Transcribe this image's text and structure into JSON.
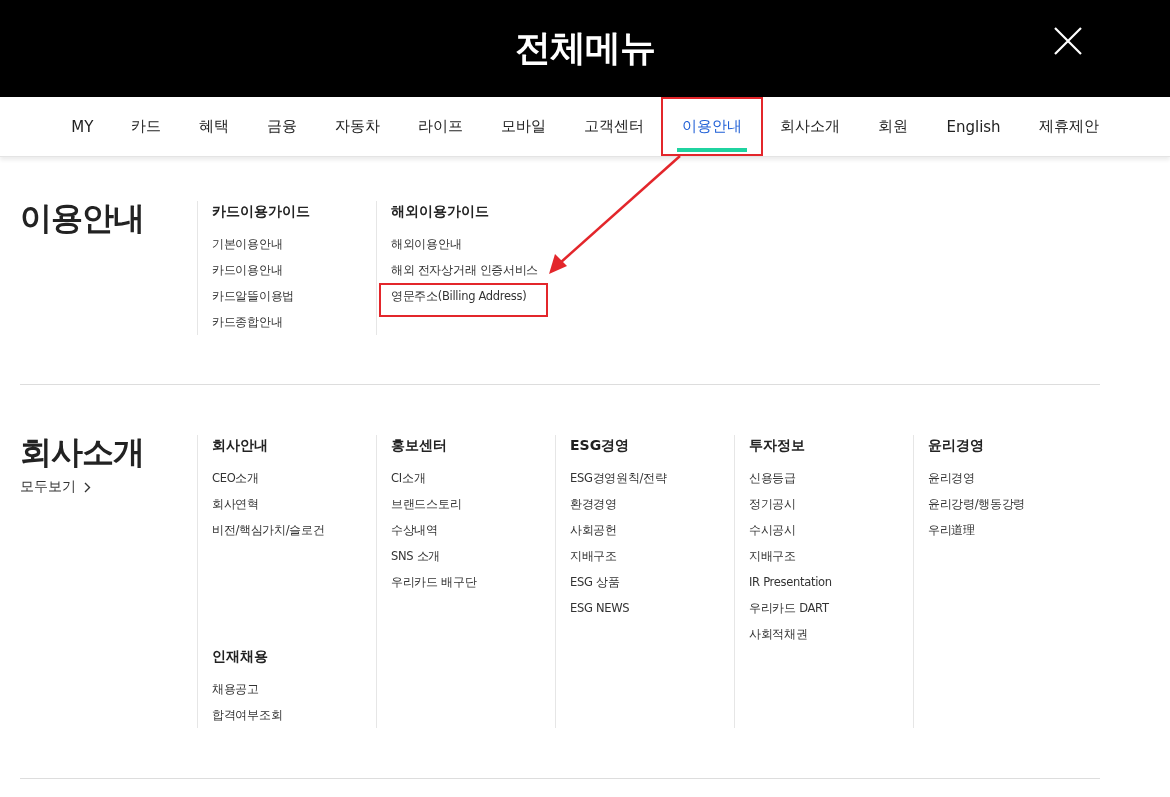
{
  "header": {
    "title": "전체메뉴"
  },
  "nav_tabs": [
    {
      "label": "MY",
      "selected": false,
      "boxed": false
    },
    {
      "label": "카드",
      "selected": false,
      "boxed": false
    },
    {
      "label": "혜택",
      "selected": false,
      "boxed": false
    },
    {
      "label": "금융",
      "selected": false,
      "boxed": false
    },
    {
      "label": "자동차",
      "selected": false,
      "boxed": false
    },
    {
      "label": "라이프",
      "selected": false,
      "boxed": false
    },
    {
      "label": "모바일",
      "selected": false,
      "boxed": false
    },
    {
      "label": "고객센터",
      "selected": false,
      "boxed": false
    },
    {
      "label": "이용안내",
      "selected": true,
      "boxed": true
    },
    {
      "label": "회사소개",
      "selected": false,
      "boxed": false
    },
    {
      "label": "회원",
      "selected": false,
      "boxed": false
    },
    {
      "label": "English",
      "selected": false,
      "boxed": false
    },
    {
      "label": "제휴제안",
      "selected": false,
      "boxed": false
    }
  ],
  "sections": [
    {
      "title": "이용안내",
      "columns": [
        [
          {
            "heading": "카드이용가이드",
            "links": [
              {
                "label": "기본이용안내",
                "boxed": false
              },
              {
                "label": "카드이용안내",
                "boxed": false
              },
              {
                "label": "카드알뜰이용법",
                "boxed": false
              },
              {
                "label": "카드종합안내",
                "boxed": false
              }
            ]
          }
        ],
        [
          {
            "heading": "해외이용가이드",
            "links": [
              {
                "label": "해외이용안내",
                "boxed": false
              },
              {
                "label": "해외 전자상거래 인증서비스",
                "boxed": false
              },
              {
                "label": "영문주소(Billing Address)",
                "boxed": true
              }
            ]
          }
        ]
      ]
    },
    {
      "title": "회사소개",
      "view_all": "모두보기",
      "columns": [
        [
          {
            "heading": "회사안내",
            "links": [
              {
                "label": "CEO소개",
                "boxed": false
              },
              {
                "label": "회사연혁",
                "boxed": false
              },
              {
                "label": "비전/핵심가치/슬로건",
                "boxed": false
              }
            ]
          },
          {
            "heading": "인재채용",
            "links": [
              {
                "label": "채용공고",
                "boxed": false
              },
              {
                "label": "합격여부조회",
                "boxed": false
              }
            ]
          }
        ],
        [
          {
            "heading": "홍보센터",
            "links": [
              {
                "label": "CI소개",
                "boxed": false
              },
              {
                "label": "브랜드스토리",
                "boxed": false
              },
              {
                "label": "수상내역",
                "boxed": false
              },
              {
                "label": "SNS 소개",
                "boxed": false
              },
              {
                "label": "우리카드 배구단",
                "boxed": false
              }
            ]
          }
        ],
        [
          {
            "heading": "ESG경영",
            "links": [
              {
                "label": "ESG경영원칙/전략",
                "boxed": false
              },
              {
                "label": "환경경영",
                "boxed": false
              },
              {
                "label": "사회공헌",
                "boxed": false
              },
              {
                "label": "지배구조",
                "boxed": false
              },
              {
                "label": "ESG 상품",
                "boxed": false
              },
              {
                "label": "ESG NEWS",
                "boxed": false
              }
            ]
          }
        ],
        [
          {
            "heading": "투자정보",
            "links": [
              {
                "label": "신용등급",
                "boxed": false
              },
              {
                "label": "정기공시",
                "boxed": false
              },
              {
                "label": "수시공시",
                "boxed": false
              },
              {
                "label": "지배구조",
                "boxed": false
              },
              {
                "label": "IR Presentation",
                "boxed": false
              },
              {
                "label": "우리카드 DART",
                "boxed": false
              },
              {
                "label": "사회적채권",
                "boxed": false
              }
            ]
          }
        ],
        [
          {
            "heading": "윤리경영",
            "links": [
              {
                "label": "윤리경영",
                "boxed": false
              },
              {
                "label": "윤리강령/행동강령",
                "boxed": false
              },
              {
                "label": "우리道理",
                "boxed": false
              }
            ]
          }
        ]
      ]
    }
  ]
}
